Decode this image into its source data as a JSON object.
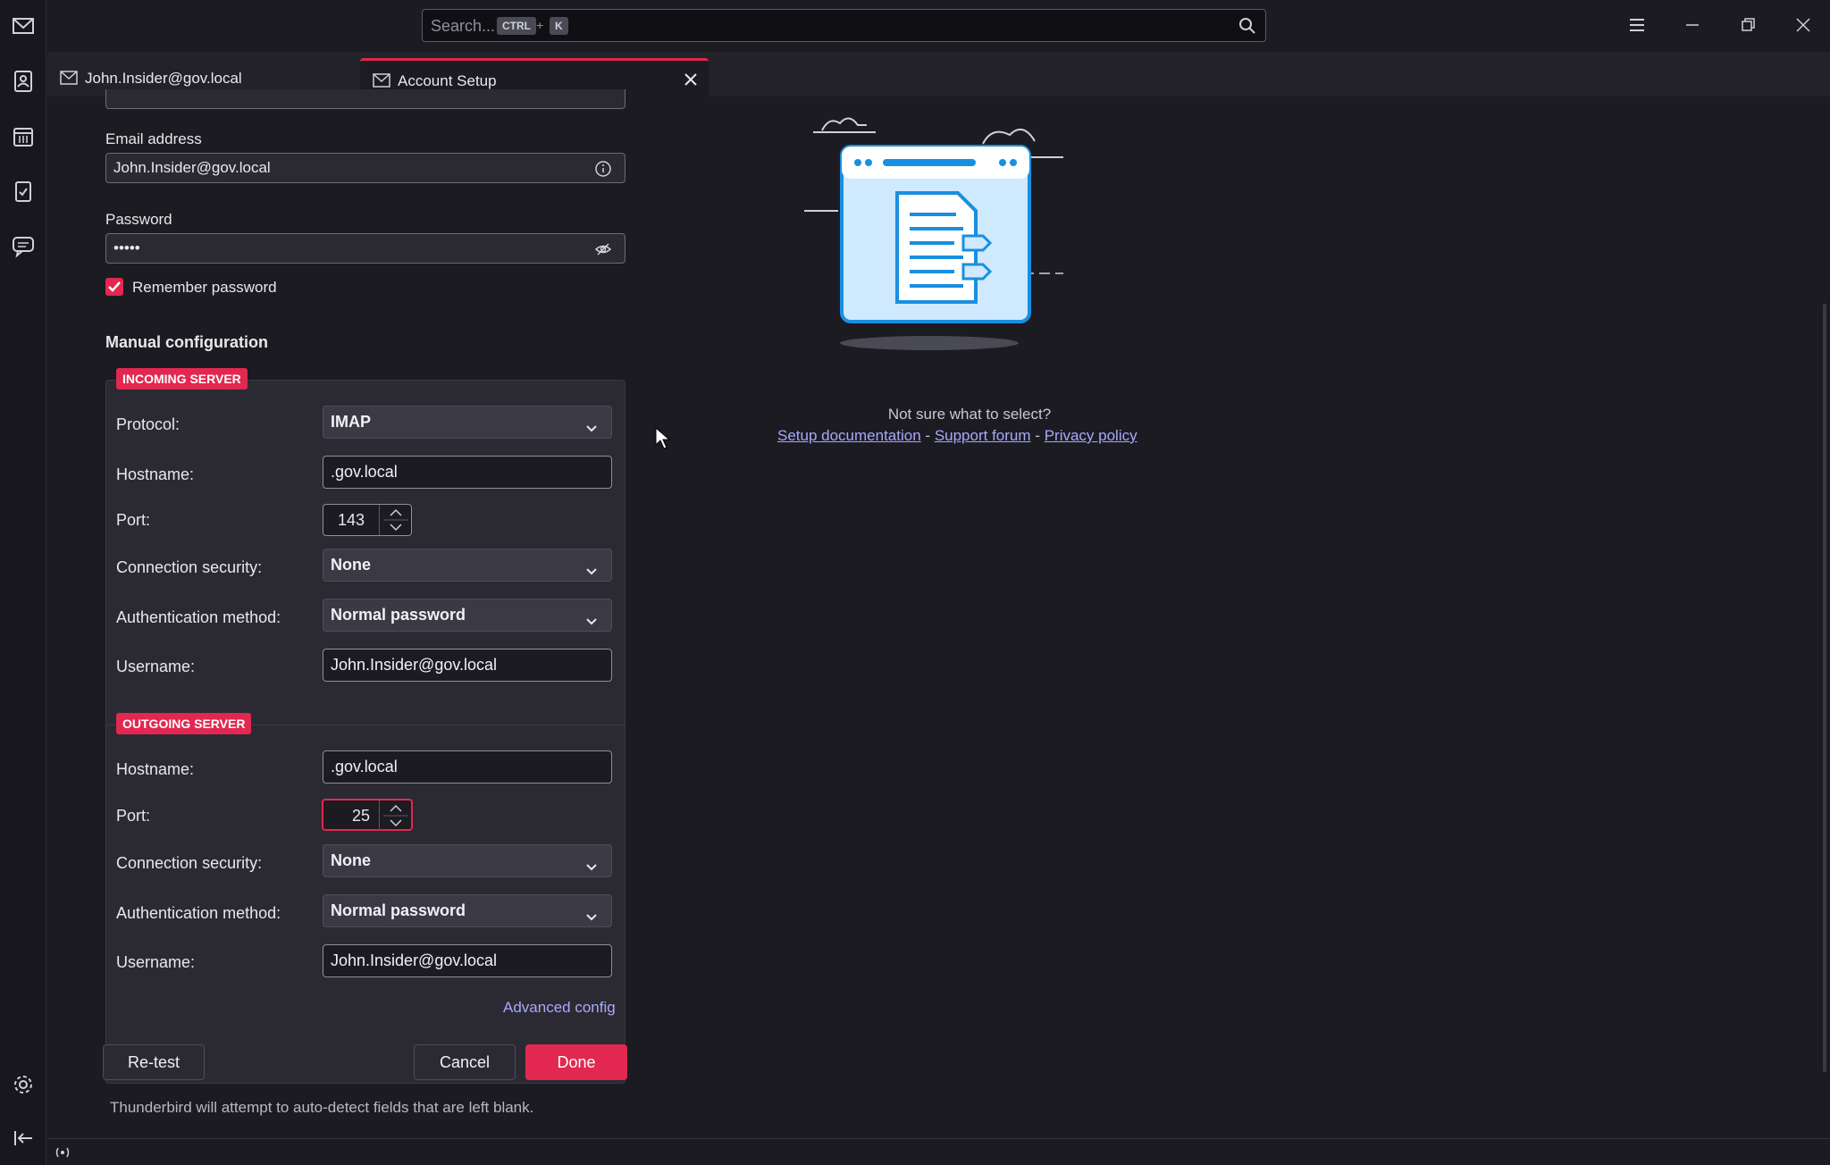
{
  "search": {
    "placeholder": "Search...",
    "shortcut_key1": "CTRL",
    "shortcut_plus": "+",
    "shortcut_key2": "K"
  },
  "tabs": [
    {
      "label": "John.Insider@gov.local"
    },
    {
      "label": "Account Setup"
    }
  ],
  "form": {
    "email_label": "Email address",
    "email_value": "John.Insider@gov.local",
    "password_label": "Password",
    "password_value": "•••••",
    "remember_label": "Remember password",
    "remember_checked": true,
    "manual_heading": "Manual configuration"
  },
  "incoming": {
    "legend": "INCOMING SERVER",
    "protocol_label": "Protocol:",
    "protocol_value": "IMAP",
    "hostname_label": "Hostname:",
    "hostname_value": ".gov.local",
    "port_label": "Port:",
    "port_value": "143",
    "security_label": "Connection security:",
    "security_value": "None",
    "auth_label": "Authentication method:",
    "auth_value": "Normal password",
    "username_label": "Username:",
    "username_value": "John.Insider@gov.local"
  },
  "outgoing": {
    "legend": "OUTGOING SERVER",
    "hostname_label": "Hostname:",
    "hostname_value": ".gov.local",
    "port_label": "Port:",
    "port_value": "25",
    "security_label": "Connection security:",
    "security_value": "None",
    "auth_label": "Authentication method:",
    "auth_value": "Normal password",
    "username_label": "Username:",
    "username_value": "John.Insider@gov.local"
  },
  "actions": {
    "advanced": "Advanced config",
    "retest": "Re-test",
    "cancel": "Cancel",
    "done": "Done",
    "hint": "Thunderbird will attempt to auto-detect fields that are left blank."
  },
  "help": {
    "question": "Not sure what to select?",
    "setup_doc": "Setup documentation",
    "sep1": "-",
    "support": "Support forum",
    "sep2": "-",
    "privacy": "Privacy policy"
  },
  "colors": {
    "accent": "#e22850",
    "link": "#a8a8ff",
    "bg": "#1c1b22"
  }
}
